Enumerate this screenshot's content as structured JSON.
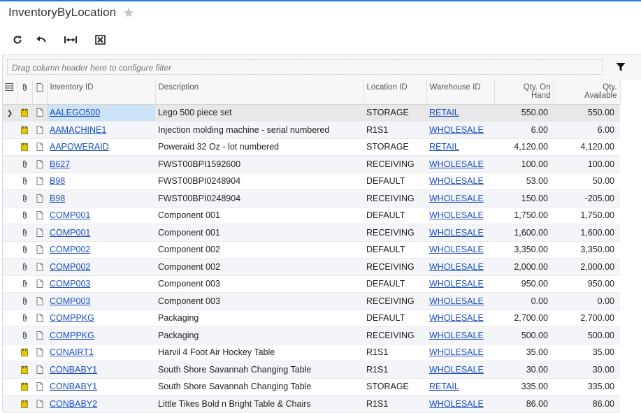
{
  "page": {
    "title": "InventoryByLocation"
  },
  "filter": {
    "placeholder": "Drag column header here to configure filter"
  },
  "columns": {
    "inventory_id": "Inventory ID",
    "description": "Description",
    "location_id": "Location ID",
    "warehouse_id": "Warehouse ID",
    "qty_on_hand_1": "Qty. On",
    "qty_on_hand_2": "Hand",
    "qty_available_1": "Qty.",
    "qty_available_2": "Available"
  },
  "rows": [
    {
      "note": true,
      "id": "AALEGO500",
      "desc": "Lego 500 piece set",
      "loc": "STORAGE",
      "wh": "RETAIL",
      "onhand": "550.00",
      "avail": "550.00"
    },
    {
      "note": true,
      "id": "AAMACHINE1",
      "desc": "Injection molding machine - serial numbered",
      "loc": "R1S1",
      "wh": "WHOLESALE",
      "onhand": "6.00",
      "avail": "6.00"
    },
    {
      "note": true,
      "id": "AAPOWERAID",
      "desc": "Poweraid 32 Oz - lot numbered",
      "loc": "STORAGE",
      "wh": "RETAIL",
      "onhand": "4,120.00",
      "avail": "4,120.00"
    },
    {
      "note": false,
      "id": "B627",
      "desc": "FWST00BPI1592600",
      "loc": "RECEIVING",
      "wh": "WHOLESALE",
      "onhand": "100.00",
      "avail": "100.00"
    },
    {
      "note": false,
      "id": "B98",
      "desc": "FWST00BPI0248904",
      "loc": "DEFAULT",
      "wh": "WHOLESALE",
      "onhand": "53.00",
      "avail": "50.00"
    },
    {
      "note": false,
      "id": "B98",
      "desc": "FWST00BPI0248904",
      "loc": "RECEIVING",
      "wh": "WHOLESALE",
      "onhand": "150.00",
      "avail": "-205.00"
    },
    {
      "note": false,
      "id": "COMP001",
      "desc": "Component 001",
      "loc": "DEFAULT",
      "wh": "WHOLESALE",
      "onhand": "1,750.00",
      "avail": "1,750.00"
    },
    {
      "note": false,
      "id": "COMP001",
      "desc": "Component 001",
      "loc": "RECEIVING",
      "wh": "WHOLESALE",
      "onhand": "1,600.00",
      "avail": "1,600.00"
    },
    {
      "note": false,
      "id": "COMP002",
      "desc": "Component 002",
      "loc": "DEFAULT",
      "wh": "WHOLESALE",
      "onhand": "3,350.00",
      "avail": "3,350.00"
    },
    {
      "note": false,
      "id": "COMP002",
      "desc": "Component 002",
      "loc": "RECEIVING",
      "wh": "WHOLESALE",
      "onhand": "2,000.00",
      "avail": "2,000.00"
    },
    {
      "note": false,
      "id": "COMP003",
      "desc": "Component 003",
      "loc": "DEFAULT",
      "wh": "WHOLESALE",
      "onhand": "950.00",
      "avail": "950.00"
    },
    {
      "note": false,
      "id": "COMP003",
      "desc": "Component 003",
      "loc": "RECEIVING",
      "wh": "WHOLESALE",
      "onhand": "0.00",
      "avail": "0.00"
    },
    {
      "note": false,
      "id": "COMPPKG",
      "desc": "Packaging",
      "loc": "DEFAULT",
      "wh": "WHOLESALE",
      "onhand": "2,700.00",
      "avail": "2,700.00"
    },
    {
      "note": false,
      "id": "COMPPKG",
      "desc": "Packaging",
      "loc": "RECEIVING",
      "wh": "WHOLESALE",
      "onhand": "500.00",
      "avail": "500.00"
    },
    {
      "note": true,
      "id": "CONAIRT1",
      "desc": "Harvil 4 Foot Air Hockey Table",
      "loc": "R1S1",
      "wh": "WHOLESALE",
      "onhand": "35.00",
      "avail": "35.00"
    },
    {
      "note": true,
      "id": "CONBABY1",
      "desc": "South Shore Savannah Changing Table",
      "loc": "R1S1",
      "wh": "WHOLESALE",
      "onhand": "30.00",
      "avail": "30.00"
    },
    {
      "note": true,
      "id": "CONBABY1",
      "desc": "South Shore Savannah Changing Table",
      "loc": "STORAGE",
      "wh": "RETAIL",
      "onhand": "335.00",
      "avail": "335.00"
    },
    {
      "note": true,
      "id": "CONBABY2",
      "desc": "Little Tikes Bold n Bright Table & Chairs",
      "loc": "R1S1",
      "wh": "WHOLESALE",
      "onhand": "86.00",
      "avail": "86.00"
    }
  ],
  "colors": {
    "link": "#1a4fc4",
    "selected_id": "#cce3f7",
    "note_icon": "#e6c800",
    "alt_row": "#f3f5f8"
  }
}
